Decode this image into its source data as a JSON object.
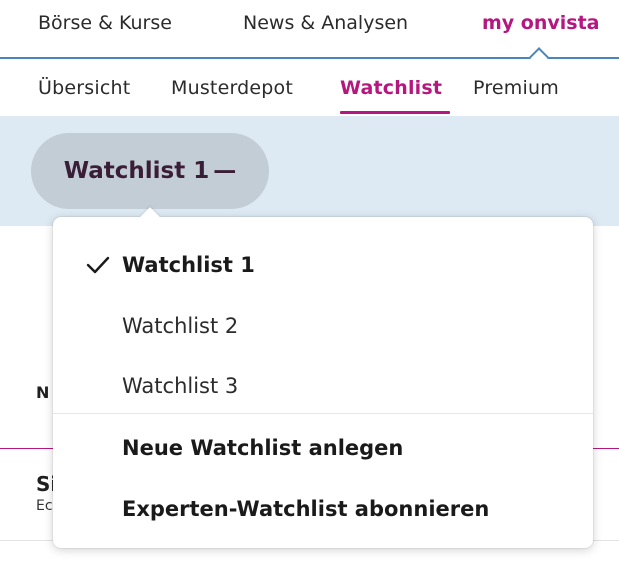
{
  "topnav": {
    "items": [
      {
        "label": "Börse & Kurse"
      },
      {
        "label": "News & Analysen"
      },
      {
        "label": "my onvista"
      }
    ]
  },
  "subnav": {
    "items": [
      {
        "label": "Übersicht"
      },
      {
        "label": "Musterdepot"
      },
      {
        "label": "Watchlist"
      },
      {
        "label": "Premium"
      }
    ]
  },
  "watchlist_selector": {
    "label": "Watchlist 1",
    "toggle_symbol": "—"
  },
  "background": {
    "frag_a": "N",
    "frag_b": "Si",
    "frag_c": "Ec"
  },
  "dropdown": {
    "items": [
      {
        "label": "Watchlist 1"
      },
      {
        "label": "Watchlist 2"
      },
      {
        "label": "Watchlist 3"
      }
    ],
    "actions": [
      {
        "label": "Neue Watchlist anlegen"
      },
      {
        "label": "Experten-Watchlist abonnieren"
      }
    ]
  },
  "colors": {
    "accent": "#b5177f",
    "nav_border": "#4a86b8",
    "band": "#dde9f3",
    "pill": "#c3cdd6"
  }
}
